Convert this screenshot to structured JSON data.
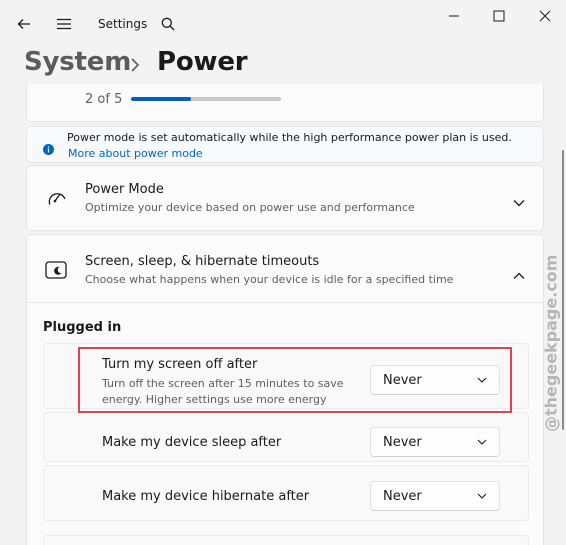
{
  "window": {
    "app_title": "Settings"
  },
  "breadcrumb": {
    "parent": "System",
    "current": "Power"
  },
  "progress": {
    "text": "2 of 5",
    "value_fraction": 0.4
  },
  "info_bar": {
    "message": "Power mode is set automatically while the high performance power plan is used.",
    "link": "More about power mode"
  },
  "power_mode": {
    "title": "Power Mode",
    "description": "Optimize your device based on power use and performance"
  },
  "timeouts": {
    "title": "Screen, sleep, & hibernate timeouts",
    "description": "Choose what happens when your device is idle for a specified time",
    "section_label": "Plugged in",
    "rows": [
      {
        "title": "Turn my screen off after",
        "description_line1": "Turn off the screen after 15 minutes to save",
        "description_line2": "energy. Higher settings use more energy",
        "value": "Never"
      },
      {
        "title": "Make my device sleep after",
        "value": "Never"
      },
      {
        "title": "Make my device hibernate after",
        "value": "Never"
      }
    ]
  },
  "watermark": "@thegeekpage.com",
  "colors": {
    "accent": "#005fb8",
    "link": "#0067c0",
    "info_icon": "#0067c0",
    "highlight": "#e0434c",
    "background": "#f3f3f3"
  },
  "icons": {
    "back": "back-arrow-icon",
    "menu": "hamburger-menu-icon",
    "search": "search-icon",
    "minimize": "minimize-icon",
    "maximize": "maximize-icon",
    "close": "close-icon",
    "info": "info-icon",
    "power_mode": "speedometer-icon",
    "timeouts": "screen-sleep-icon"
  }
}
